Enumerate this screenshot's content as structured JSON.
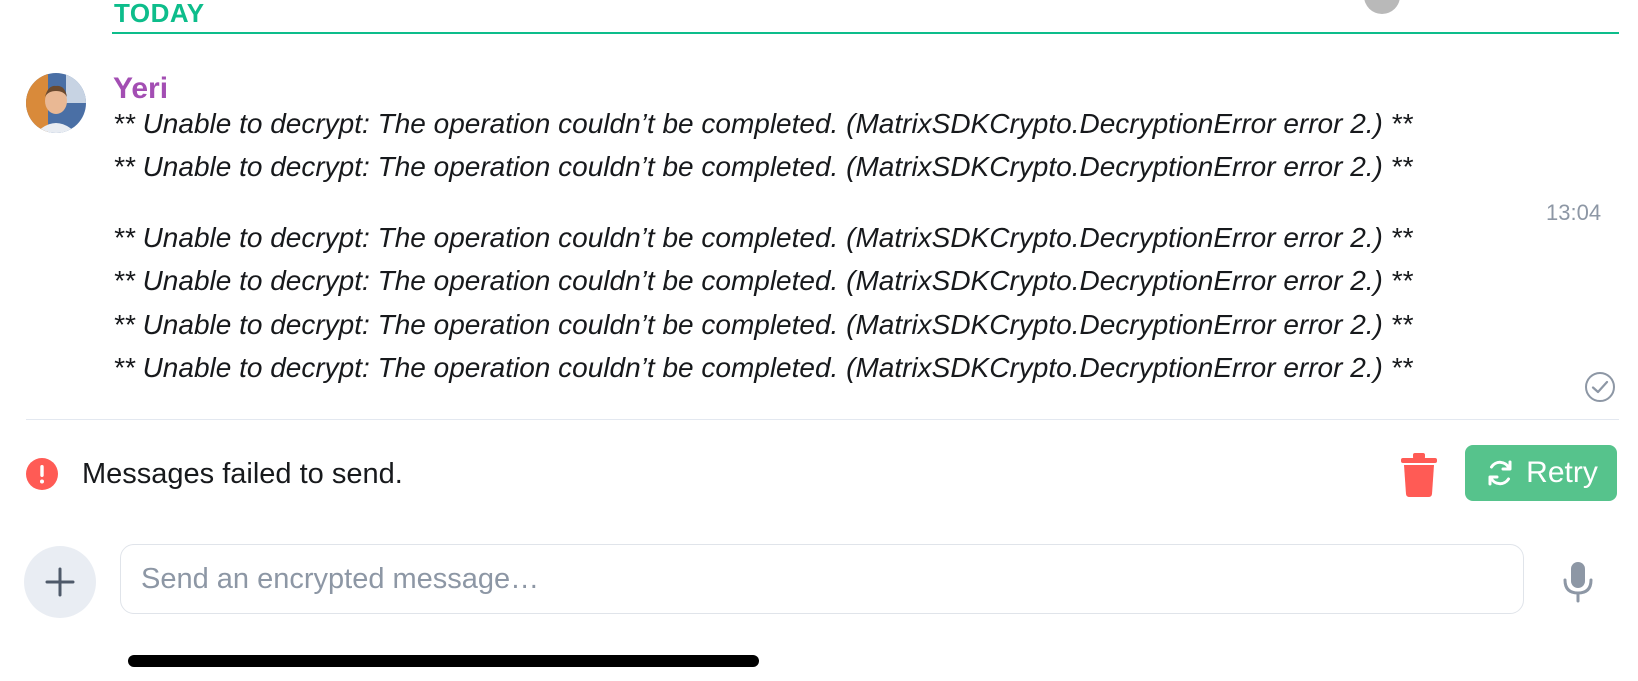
{
  "timeline": {
    "date_separator": "TODAY",
    "sender_name": "Yeri",
    "messages": [
      "** Unable to decrypt: The operation couldn’t be completed. (MatrixSDKCrypto.DecryptionError error 2.) **",
      "** Unable to decrypt: The operation couldn’t be completed. (MatrixSDKCrypto.DecryptionError error 2.) **",
      "** Unable to decrypt: The operation couldn’t be completed. (MatrixSDKCrypto.DecryptionError error 2.) **",
      "** Unable to decrypt: The operation couldn’t be completed. (MatrixSDKCrypto.DecryptionError error 2.) **",
      "** Unable to decrypt: The operation couldn’t be completed. (MatrixSDKCrypto.DecryptionError error 2.) **",
      "** Unable to decrypt: The operation couldn’t be completed. (MatrixSDKCrypto.DecryptionError error 2.) **"
    ],
    "timestamp": "13:04"
  },
  "failed_bar": {
    "text": "Messages failed to send.",
    "retry_label": "Retry",
    "icons": {
      "error": "exclamation-circle-icon",
      "delete": "trash-icon",
      "retry": "refresh-icon"
    }
  },
  "composer": {
    "placeholder": "Send an encrypted message…",
    "icons": {
      "attach": "plus-icon",
      "voice": "microphone-icon"
    }
  },
  "colors": {
    "accent": "#0dbd8b",
    "sender": "#a34eb3",
    "error": "#ff5b55",
    "retry": "#56c38c"
  }
}
